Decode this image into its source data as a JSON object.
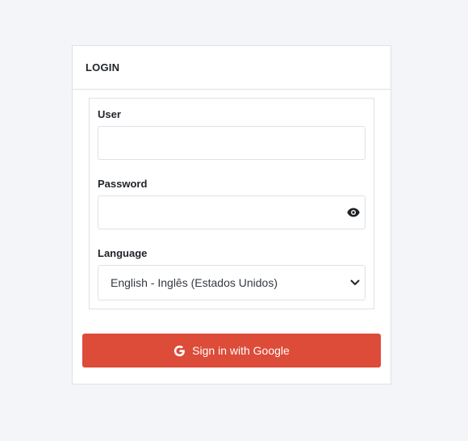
{
  "login": {
    "title": "LOGIN",
    "user_label": "User",
    "user_value": "",
    "password_label": "Password",
    "password_value": "",
    "password_toggle_icon": "eye-icon",
    "language_label": "Language",
    "language_selected": "English - Inglês (Estados Unidos)",
    "google_button_label": "Sign in with Google",
    "google_icon": "google-g-icon"
  },
  "colors": {
    "background": "#f4f5f9",
    "card": "#ffffff",
    "border": "#dfe1e6",
    "google_button": "#dd4b39",
    "text": "#212529"
  }
}
